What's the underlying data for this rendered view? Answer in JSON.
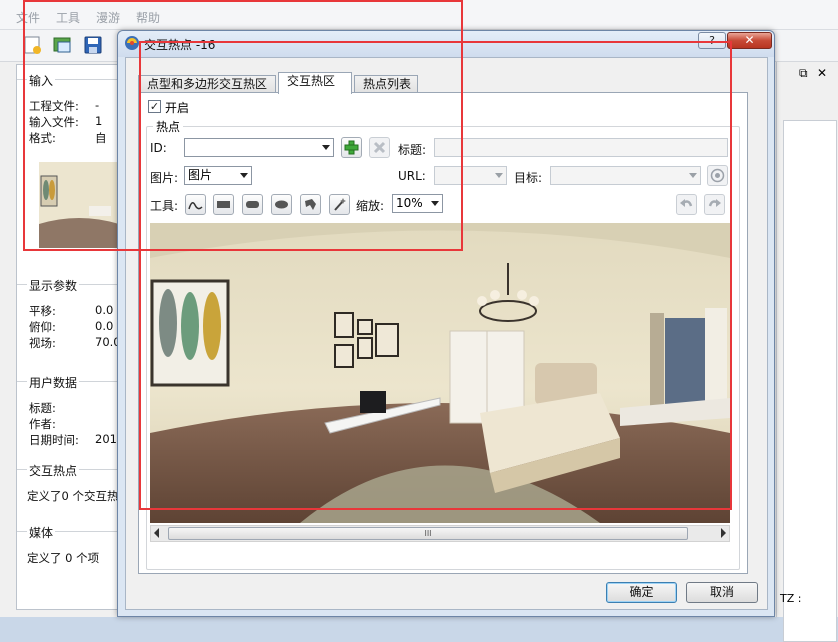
{
  "app": {
    "menu": [
      "文件",
      "工具",
      "漫游",
      "帮助"
    ],
    "left": {
      "input_group": "输入",
      "input_rows": [
        {
          "label": "工程文件:",
          "value": "-"
        },
        {
          "label": "输入文件:",
          "value": "1"
        },
        {
          "label": "格式:",
          "value": "自"
        }
      ],
      "display_group": "显示参数",
      "display_rows": [
        {
          "label": "平移:",
          "value": "0.0"
        },
        {
          "label": "俯仰:",
          "value": "0.0"
        },
        {
          "label": "视场:",
          "value": "70.00"
        }
      ],
      "user_group": "用户数据",
      "user_rows": [
        {
          "label": "标题:",
          "value": ""
        },
        {
          "label": "作者:",
          "value": ""
        },
        {
          "label": "日期时间:",
          "value": "201"
        }
      ],
      "hotspot_group": "交互热点",
      "hotspot_text": "定义了0 个交互热",
      "media_group": "媒体",
      "media_text": "定义了 0 个项"
    },
    "right": {
      "float_icon": "⧉",
      "close_icon": "✕",
      "tz_label": "TZ :"
    }
  },
  "dialog": {
    "title": "交互热点 -16",
    "help": "?",
    "close": "✕",
    "tabs": [
      "点型和多边形交互热区",
      "交互热区",
      "热点列表"
    ],
    "active_tab": 1,
    "enabled_label": "开启",
    "enabled_checked": true,
    "hotspot_group": "热点",
    "id_label": "ID:",
    "id_value": "",
    "title_label": "标题:",
    "image_label": "图片:",
    "image_value": "图片",
    "url_label": "URL:",
    "target_label": "目标:",
    "tools_label": "工具:",
    "zoom_label": "缩放:",
    "zoom_value": "10%",
    "scroll_grip": "III",
    "ok": "确定",
    "cancel": "取消"
  }
}
